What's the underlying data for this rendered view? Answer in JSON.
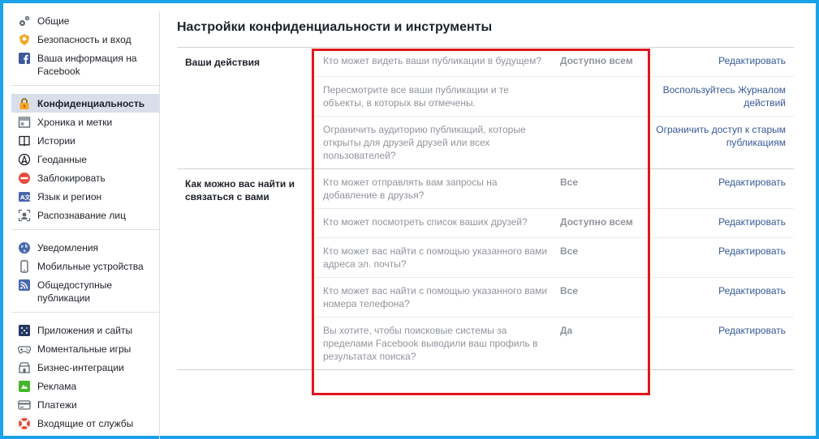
{
  "sidebar": {
    "groups": [
      [
        {
          "label": "Общие",
          "icon": "gears-icon",
          "active": false
        },
        {
          "label": "Безопасность и вход",
          "icon": "badge-icon",
          "active": false
        },
        {
          "label": "Ваша информация на Facebook",
          "icon": "facebook-icon",
          "active": false
        }
      ],
      [
        {
          "label": "Конфиденциальность",
          "icon": "lock-icon",
          "active": true
        },
        {
          "label": "Хроника и метки",
          "icon": "timeline-icon",
          "active": false
        },
        {
          "label": "Истории",
          "icon": "book-icon",
          "active": false
        },
        {
          "label": "Геоданные",
          "icon": "location-icon",
          "active": false
        },
        {
          "label": "Заблокировать",
          "icon": "block-icon",
          "active": false
        },
        {
          "label": "Язык и регион",
          "icon": "language-icon",
          "active": false
        },
        {
          "label": "Распознавание лиц",
          "icon": "face-icon",
          "active": false
        }
      ],
      [
        {
          "label": "Уведомления",
          "icon": "globe-icon",
          "active": false
        },
        {
          "label": "Мобильные устройства",
          "icon": "mobile-icon",
          "active": false
        },
        {
          "label": "Общедоступные публикации",
          "icon": "rss-icon",
          "active": false
        }
      ],
      [
        {
          "label": "Приложения и сайты",
          "icon": "apps-icon",
          "active": false
        },
        {
          "label": "Моментальные игры",
          "icon": "gamepad-icon",
          "active": false
        },
        {
          "label": "Бизнес-интеграции",
          "icon": "business-icon",
          "active": false
        },
        {
          "label": "Реклама",
          "icon": "ads-icon",
          "active": false
        },
        {
          "label": "Платежи",
          "icon": "card-icon",
          "active": false
        },
        {
          "label": "Входящие от службы",
          "icon": "lifebuoy-icon",
          "active": false
        }
      ]
    ]
  },
  "main": {
    "title": "Настройки конфиденциальности и инструменты",
    "sections": [
      {
        "title": "Ваши действия",
        "rows": [
          {
            "question": "Кто может видеть ваши публикации в будущем?",
            "value": "Доступно всем",
            "action": "Редактировать"
          },
          {
            "question": "Пересмотрите все ваши публикации и те объекты, в которых вы отмечены.",
            "value": "",
            "action": "Воспользуйтесь Журналом действий"
          },
          {
            "question": "Ограничить аудиторию публикаций, которые открыты для друзей друзей или всех пользователей?",
            "value": "",
            "action": "Ограничить доступ к старым публикациям"
          }
        ]
      },
      {
        "title": "Как можно вас найти и связаться с вами",
        "rows": [
          {
            "question": "Кто может отправлять вам запросы на добавление в друзья?",
            "value": "Все",
            "action": "Редактировать"
          },
          {
            "question": "Кто может посмотреть список ваших друзей?",
            "value": "Доступно всем",
            "action": "Редактировать"
          },
          {
            "question": "Кто может вас найти с помощью указанного вами адреса эл. почты?",
            "value": "Все",
            "action": "Редактировать"
          },
          {
            "question": "Кто может вас найти с помощью указанного вами номера телефона?",
            "value": "Все",
            "action": "Редактировать"
          },
          {
            "question": "Вы хотите, чтобы поисковые системы за пределами Facebook выводили ваш профиль в результатах поиска?",
            "value": "Да",
            "action": "Редактировать"
          }
        ]
      }
    ]
  },
  "colors": {
    "frame": "#1aa3e8",
    "highlight": "#e0161f",
    "link": "#365899",
    "active_bg": "#d8dfea",
    "muted": "#90949c"
  }
}
